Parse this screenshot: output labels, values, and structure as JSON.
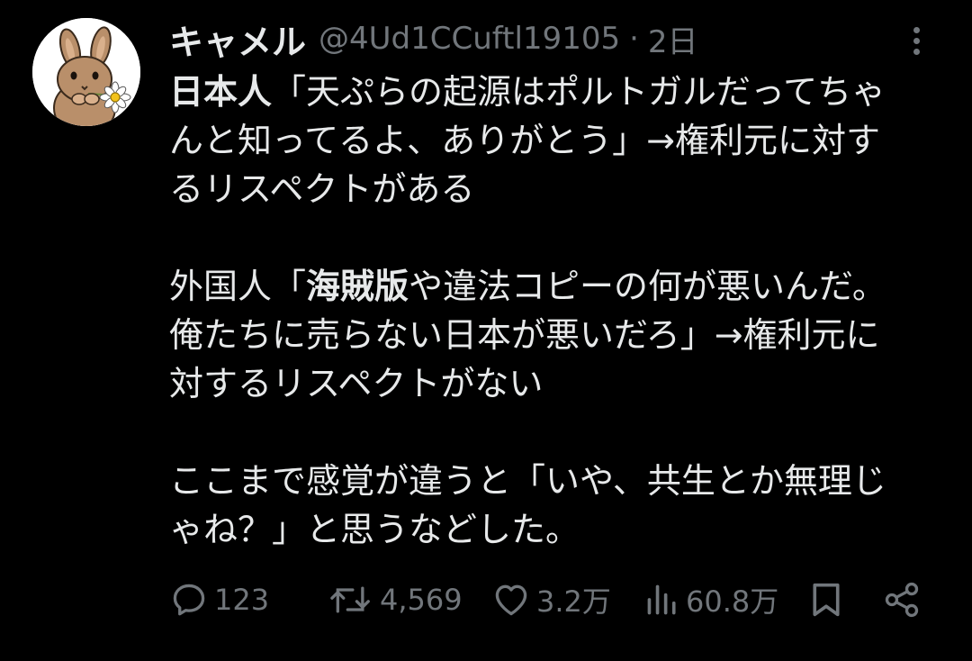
{
  "author": {
    "display_name": "キャメル",
    "handle": "@4Ud1CCuftl19105",
    "separator": "·",
    "time": "2日"
  },
  "body": {
    "lines": [
      [
        "日本人",
        "「天ぷらの起源はポルトガルだってちゃ"
      ],
      "んと知ってるよ、ありがとう」→権利元に対す",
      "るリスペクトがある",
      "",
      [
        "外国人「",
        "海賊版",
        "や違法コピーの何が悪いんだ。"
      ],
      "俺たちに売らない日本が悪いだろ」→権利元に",
      "対するリスペクトがない",
      "",
      "ここまで感覚が違うと「いや、共生とか無理じ",
      "ゃね？」と思うなどした。"
    ]
  },
  "actions": {
    "replies": "123",
    "reposts": "4,569",
    "likes": "3.2万",
    "views": "60.8万"
  },
  "icons": {
    "avatar": "rabbit-with-daisy-avatar",
    "more": "more-options-icon",
    "reply": "reply-icon",
    "repost": "repost-icon",
    "like": "heart-icon",
    "views": "views-bar-icon",
    "bookmark": "bookmark-icon",
    "share": "share-icon"
  },
  "colors": {
    "background": "#000000",
    "text": "#e7e9ea",
    "muted": "#71767b"
  }
}
